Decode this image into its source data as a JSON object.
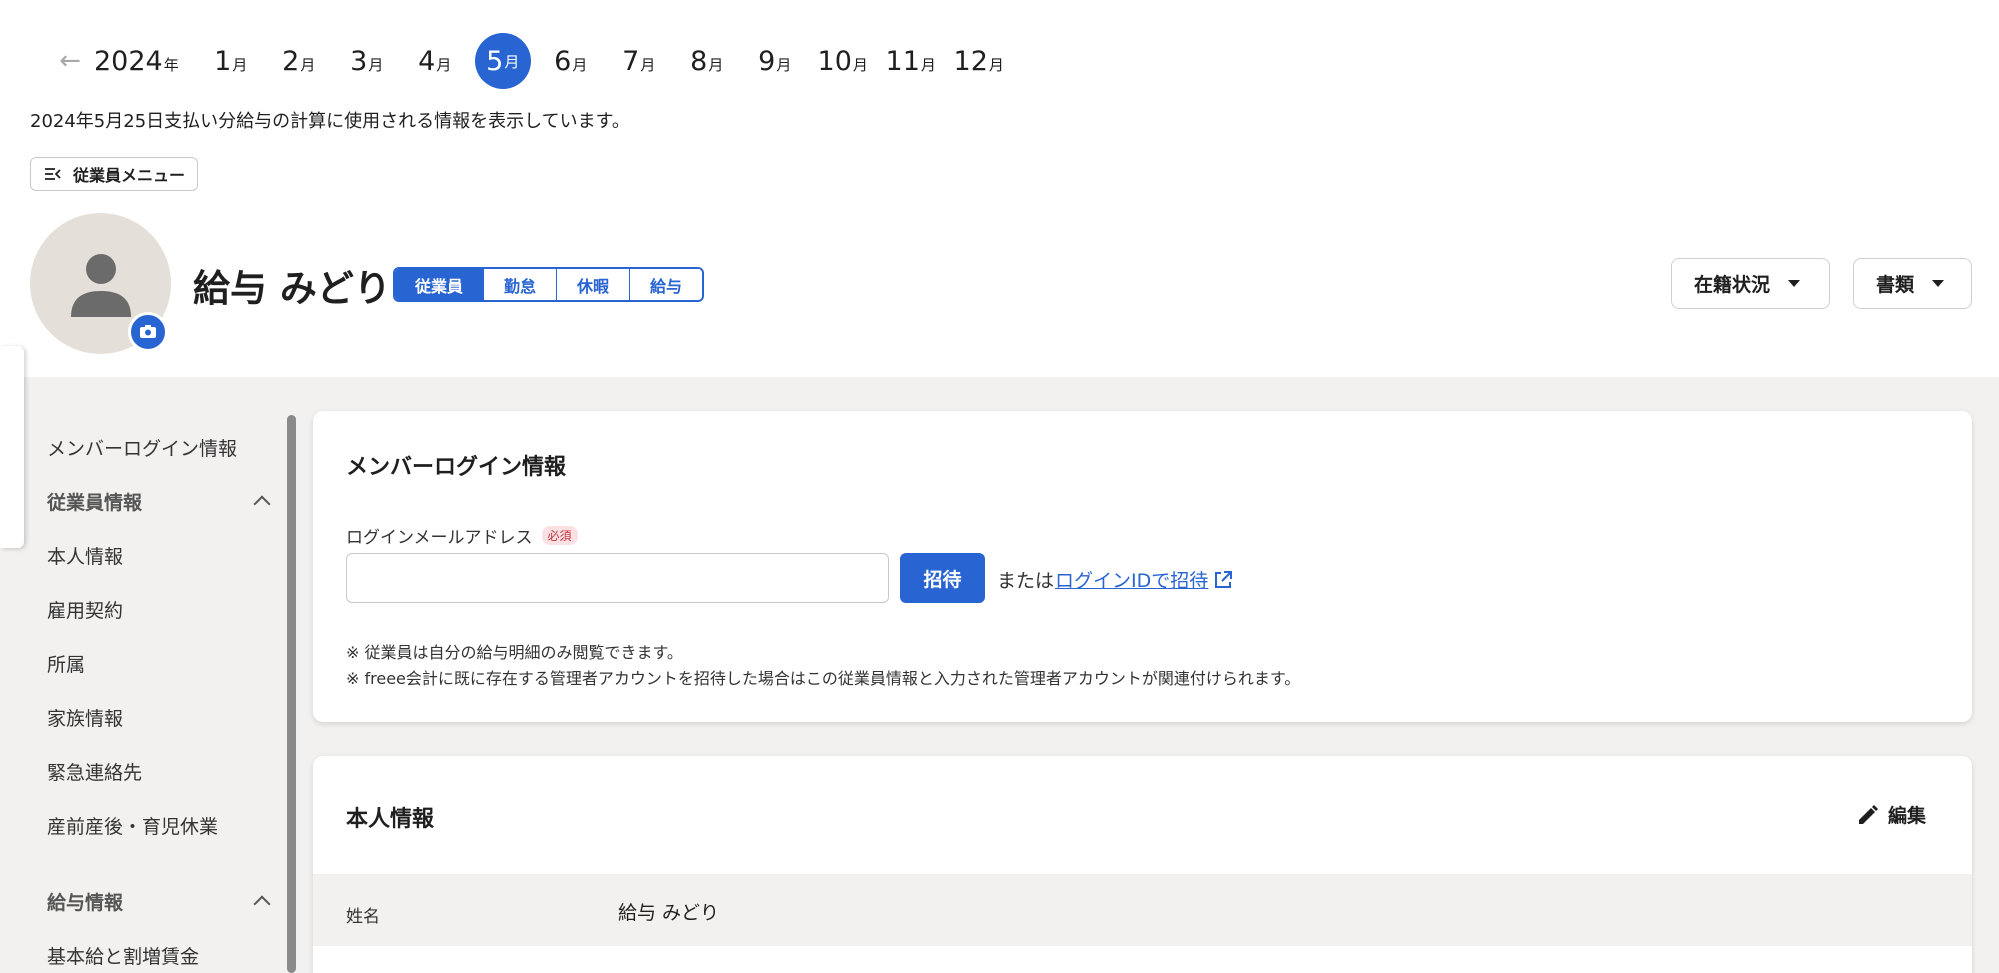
{
  "month_nav": {
    "year": "2024",
    "year_unit": "年",
    "month_unit": "月",
    "months": [
      "1",
      "2",
      "3",
      "4",
      "5",
      "6",
      "7",
      "8",
      "9",
      "10",
      "11",
      "12"
    ],
    "active_month": "5"
  },
  "pay_info_text": "2024年5月25日支払い分給与の計算に使用される情報を表示しています。",
  "employee_menu_label": "従業員メニュー",
  "employee": {
    "name": "給与 みどり"
  },
  "tabs": [
    "従業員",
    "勤怠",
    "休暇",
    "給与"
  ],
  "header_actions": {
    "status": "在籍状況",
    "documents": "書類"
  },
  "sidebar": {
    "login_info": "メンバーログイン情報",
    "employee_group": "従業員情報",
    "employee_items": [
      "本人情報",
      "雇用契約",
      "所属",
      "家族情報",
      "緊急連絡先",
      "産前産後・育児休業"
    ],
    "salary_group": "給与情報",
    "salary_items": [
      "基本給と割増賃金"
    ]
  },
  "login_card": {
    "title": "メンバーログイン情報",
    "email_label": "ログインメールアドレス",
    "required_badge": "必須",
    "email_value": "",
    "invite_button": "招待",
    "or_text": "または",
    "login_id_link": "ログインIDで招待",
    "notes": [
      "※ 従業員は自分の給与明細のみ閲覧できます。",
      "※ freee会計に既に存在する管理者アカウントを招待した場合はこの従業員情報と入力された管理者アカウントが関連付けられます。"
    ]
  },
  "personal_card": {
    "title": "本人情報",
    "edit_button": "編集",
    "rows": [
      {
        "key": "姓名",
        "value": "給与 みどり"
      }
    ]
  },
  "colors": {
    "accent": "#2864d2",
    "required": "#c0333f",
    "background_gray": "#f2f1f0"
  },
  "icons": [
    "arrow-left-icon",
    "menu-collapse-icon",
    "person-icon",
    "camera-icon",
    "caret-down-icon",
    "chevron-up-icon",
    "external-link-icon",
    "pencil-icon"
  ]
}
